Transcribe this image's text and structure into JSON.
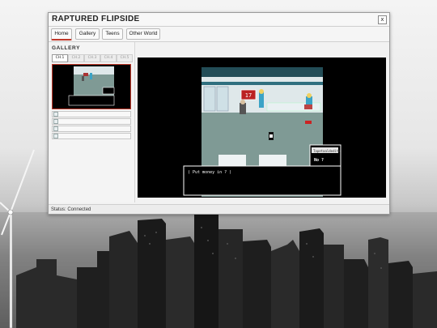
{
  "window": {
    "title": "RAPTURED FLIPSIDE",
    "close_icon": "close-icon",
    "close_label": "x"
  },
  "tabs": [
    {
      "label": "Home",
      "active": true
    },
    {
      "label": "Gallery",
      "active": false
    },
    {
      "label": "Teens",
      "active": false
    },
    {
      "label": "Other World",
      "active": false
    }
  ],
  "gallery": {
    "heading": "GALLERY",
    "chapters": [
      {
        "label": "CH.1",
        "active": true
      },
      {
        "label": "CH.2",
        "active": false
      },
      {
        "label": "CH.3",
        "active": false
      },
      {
        "label": "CH.4",
        "active": false
      },
      {
        "label": "CH.5",
        "active": false
      }
    ],
    "broken_images": 4
  },
  "game": {
    "dialog_text": "( Put money in ? )",
    "choice_title": "Tapetaaldedite",
    "choice_option": "No ?",
    "sign_text": "17"
  },
  "status": {
    "text": "Status: Connected"
  },
  "colors": {
    "accent": "#c0392b",
    "floor": "#7f9a95",
    "wall": "#dfe8ea"
  }
}
